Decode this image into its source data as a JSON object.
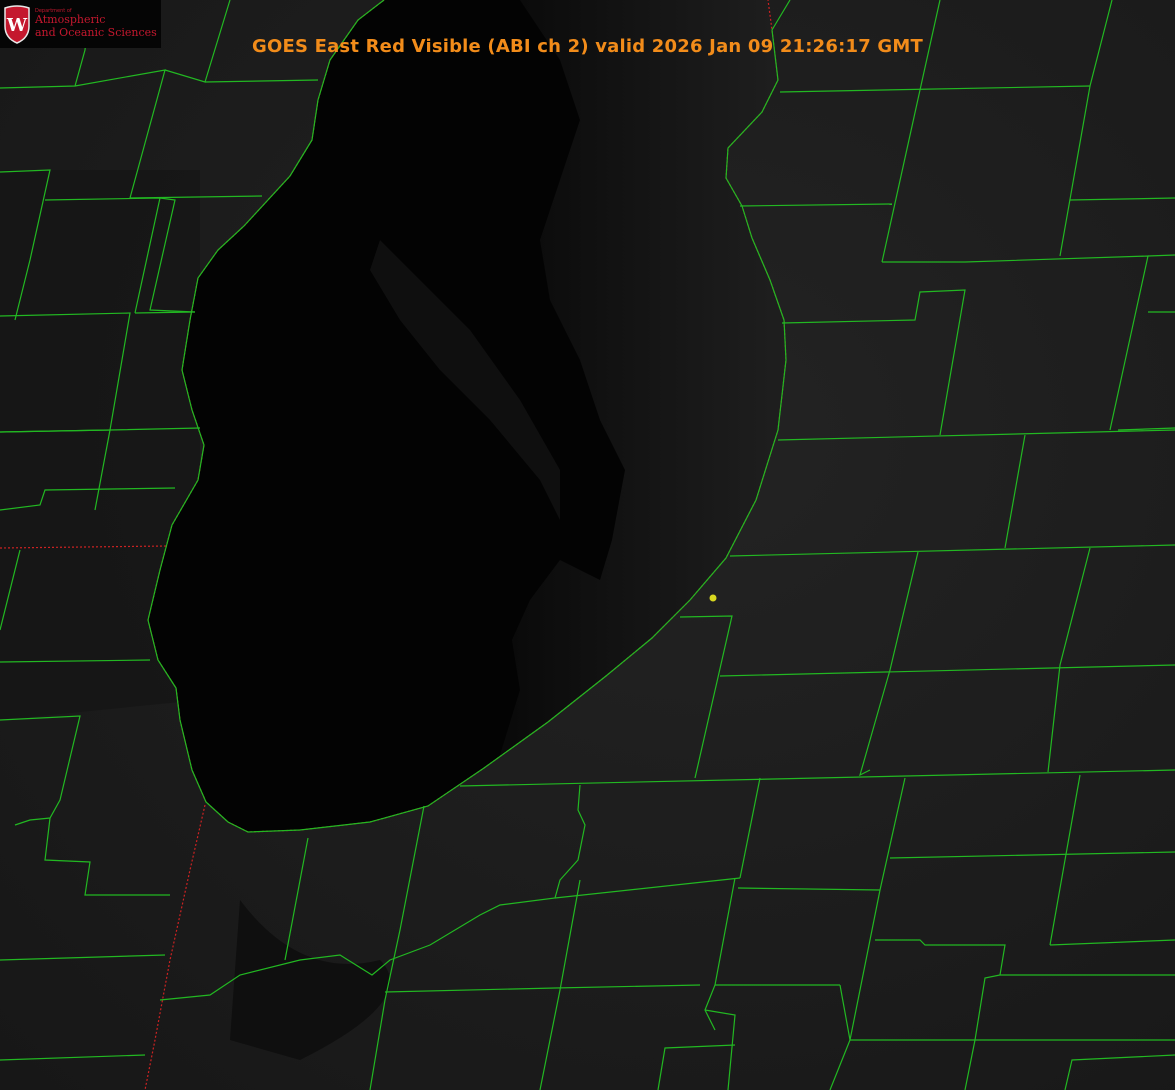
{
  "title": "GOES East Red Visible (ABI ch 2) valid 2026 Jan 09 21:26:17 GMT",
  "logo": {
    "dept_small": "Department of",
    "line1": "Atmospheric",
    "line2": "and Oceanic Sciences",
    "letter": "W"
  },
  "colors": {
    "background": "#000000",
    "land": "#1c1c1c",
    "lake": "#030303",
    "county_lines": "#22b822",
    "state_line": "#cc2222",
    "title_text": "#f28c1a",
    "marker": "#d8d820",
    "logo_red": "#c4182e"
  },
  "map": {
    "features": [
      "lake-michigan-southern-basin",
      "county-boundaries",
      "state-boundaries",
      "point-marker"
    ]
  }
}
